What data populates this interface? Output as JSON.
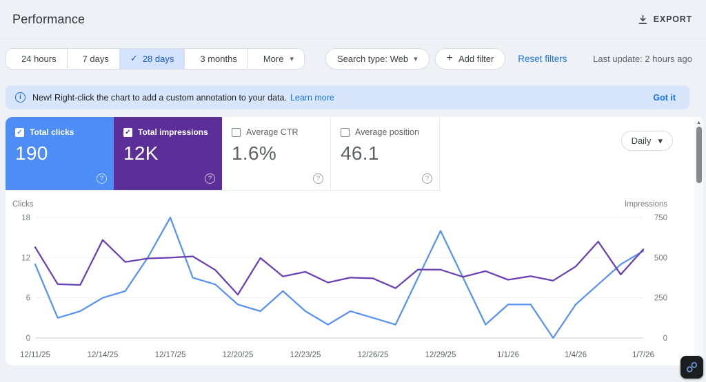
{
  "header": {
    "title": "Performance",
    "export_label": "EXPORT"
  },
  "toolbar": {
    "date_ranges": [
      {
        "label": "24 hours",
        "selected": false
      },
      {
        "label": "7 days",
        "selected": false
      },
      {
        "label": "28 days",
        "selected": true
      },
      {
        "label": "3 months",
        "selected": false
      },
      {
        "label": "More",
        "selected": false,
        "has_caret": true
      }
    ],
    "search_type_label": "Search type: Web",
    "add_filter_label": "Add filter",
    "reset_filters_label": "Reset filters",
    "last_update": "Last update: 2 hours ago"
  },
  "banner": {
    "message": "New! Right-click the chart to add a custom annotation to your data.",
    "learn_more_label": "Learn more",
    "dismiss_label": "Got it"
  },
  "metrics": [
    {
      "label": "Total clicks",
      "value": "190",
      "checked": true,
      "color": "#4d8df5"
    },
    {
      "label": "Total impressions",
      "value": "12K",
      "checked": true,
      "color": "#5c2f98"
    },
    {
      "label": "Average CTR",
      "value": "1.6%",
      "checked": false
    },
    {
      "label": "Average position",
      "value": "46.1",
      "checked": false
    }
  ],
  "granularity": {
    "selected": "Daily"
  },
  "icons": {
    "check": "✓",
    "caret": "▾",
    "plus": "+",
    "question": "?",
    "info": "i",
    "up_arrow": "▲"
  },
  "chart_data": {
    "type": "line",
    "x": [
      "12/11/25",
      "12/12/25",
      "12/13/25",
      "12/14/25",
      "12/15/25",
      "12/16/25",
      "12/17/25",
      "12/18/25",
      "12/19/25",
      "12/20/25",
      "12/21/25",
      "12/22/25",
      "12/23/25",
      "12/24/25",
      "12/25/25",
      "12/26/25",
      "12/27/25",
      "12/28/25",
      "12/29/25",
      "12/30/25",
      "12/31/25",
      "1/1/26",
      "1/2/26",
      "1/3/26",
      "1/4/26",
      "1/5/26",
      "1/6/26",
      "1/7/26"
    ],
    "x_tick_labels": [
      "12/11/25",
      "12/14/25",
      "12/17/25",
      "12/20/25",
      "12/23/25",
      "12/26/25",
      "12/29/25",
      "1/1/26",
      "1/4/26",
      "1/7/26"
    ],
    "series": [
      {
        "name": "Clicks",
        "axis": "left",
        "color": "#5b93f0",
        "values": [
          11,
          3,
          4,
          6,
          7,
          12,
          18,
          9,
          8,
          5,
          4,
          7,
          4,
          2,
          4,
          3,
          2,
          9,
          16,
          9,
          2,
          5,
          5,
          0,
          5,
          8,
          11,
          13
        ]
      },
      {
        "name": "Impressions",
        "axis": "right",
        "color": "#6a42b4",
        "values": [
          565,
          335,
          330,
          610,
          473,
          495,
          500,
          508,
          423,
          270,
          498,
          383,
          412,
          345,
          376,
          371,
          310,
          426,
          425,
          380,
          416,
          362,
          385,
          357,
          445,
          600,
          395,
          551
        ]
      }
    ],
    "left_axis": {
      "label": "Clicks",
      "ticks": [
        18,
        12,
        6,
        0
      ],
      "max": 18
    },
    "right_axis": {
      "label": "Impressions",
      "ticks": [
        750,
        500,
        250,
        0
      ],
      "max": 750
    },
    "grid": true,
    "legend_position": "none"
  }
}
